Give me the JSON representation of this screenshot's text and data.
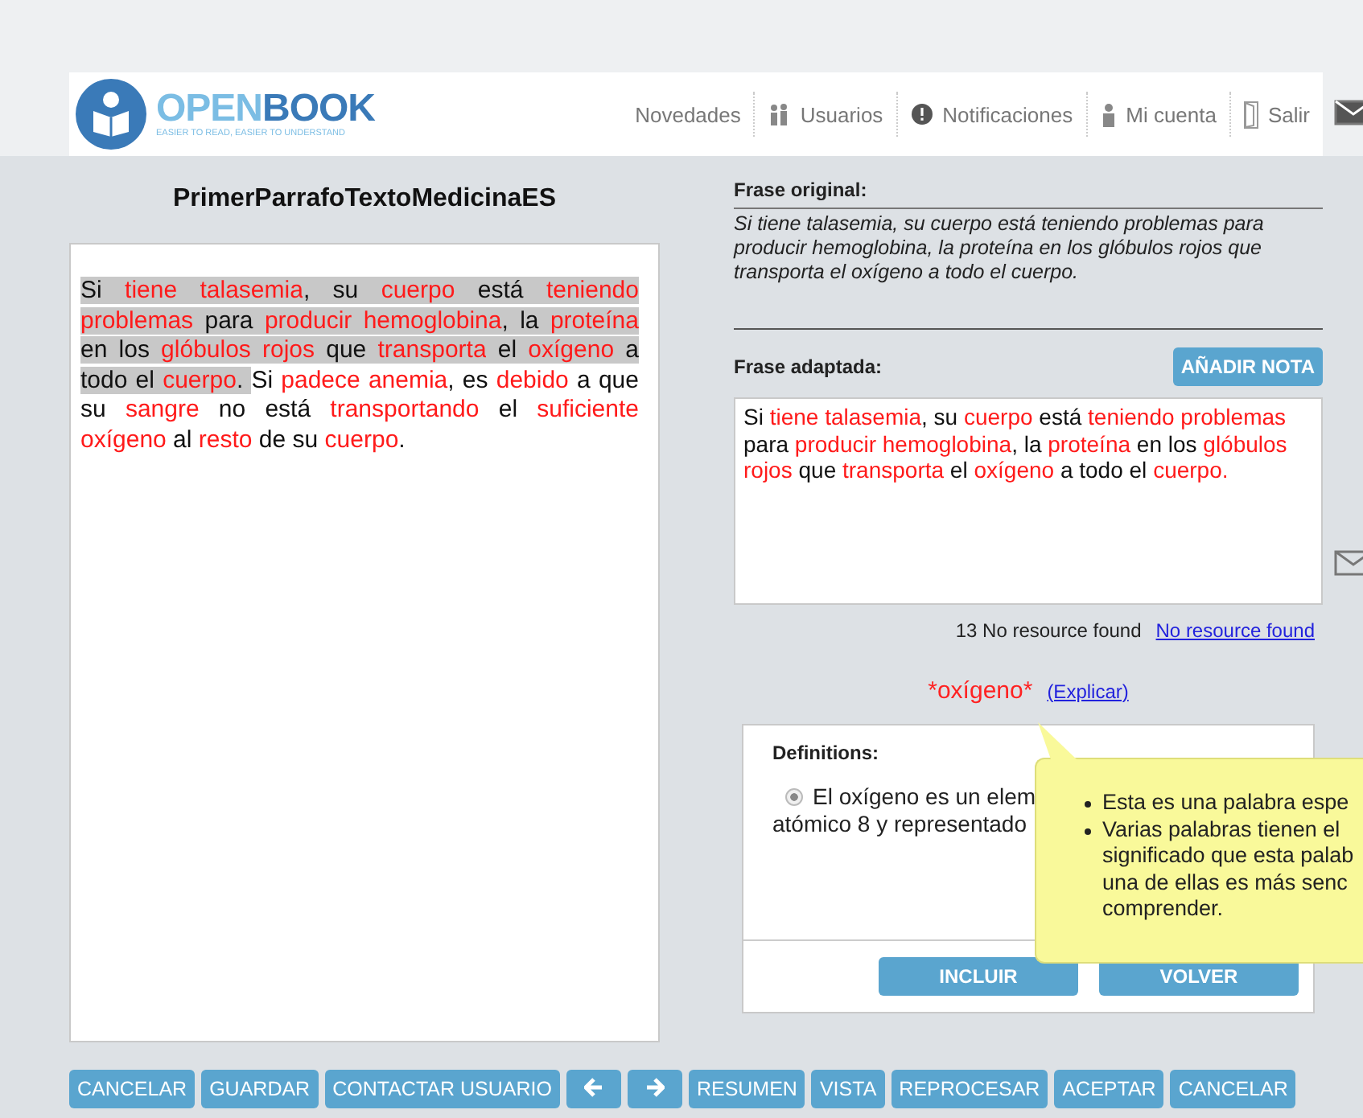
{
  "logo": {
    "name_first": "OPEN",
    "name_second": "BOOK",
    "tagline": "EASIER TO READ, EASIER TO UNDERSTAND"
  },
  "nav": [
    {
      "label": "Novedades",
      "kind": "plain"
    },
    {
      "label": "Usuarios",
      "kind": "users"
    },
    {
      "label": "Notificaciones",
      "kind": "alert"
    },
    {
      "label": "Mi cuenta",
      "kind": "person"
    },
    {
      "label": "Salir",
      "kind": "door"
    }
  ],
  "document": {
    "title": "PrimerParrafoTextoMedicinaES",
    "sentences": [
      {
        "selected": true,
        "segments": [
          {
            "text": "Si ",
            "difficult": false
          },
          {
            "text": "tiene talasemia",
            "difficult": true
          },
          {
            "text": ", su ",
            "difficult": false
          },
          {
            "text": "cuerpo",
            "difficult": true
          },
          {
            "text": " está ",
            "difficult": false
          },
          {
            "text": "teniendo problemas",
            "difficult": true
          },
          {
            "text": " para ",
            "difficult": false
          },
          {
            "text": "producir hemoglobina",
            "difficult": true
          },
          {
            "text": ", la ",
            "difficult": false
          },
          {
            "text": "proteína",
            "difficult": true
          },
          {
            "text": " en los ",
            "difficult": false
          },
          {
            "text": "glóbulos rojos",
            "difficult": true
          },
          {
            "text": " que ",
            "difficult": false
          },
          {
            "text": "transporta",
            "difficult": true
          },
          {
            "text": " el ",
            "difficult": false
          },
          {
            "text": "oxígeno",
            "difficult": true
          },
          {
            "text": " a todo el ",
            "difficult": false
          },
          {
            "text": "cuerpo",
            "difficult": true
          },
          {
            "text": ". ",
            "difficult": false
          }
        ]
      },
      {
        "selected": false,
        "segments": [
          {
            "text": "Si ",
            "difficult": false
          },
          {
            "text": "padece anemia",
            "difficult": true
          },
          {
            "text": ", es ",
            "difficult": false
          },
          {
            "text": "debido",
            "difficult": true
          },
          {
            "text": " a que su ",
            "difficult": false
          },
          {
            "text": "sangre",
            "difficult": true
          },
          {
            "text": " no está ",
            "difficult": false
          },
          {
            "text": "transportando",
            "difficult": true
          },
          {
            "text": " el ",
            "difficult": false
          },
          {
            "text": "suficiente",
            "difficult": true
          },
          {
            "text": " oxígeno",
            "difficult": true
          },
          {
            "text": " al ",
            "difficult": false
          },
          {
            "text": "resto",
            "difficult": true
          },
          {
            "text": " de su ",
            "difficult": false
          },
          {
            "text": "cuerpo",
            "difficult": true
          },
          {
            "text": ".",
            "difficult": false
          }
        ]
      }
    ]
  },
  "original": {
    "label": "Frase original:",
    "text": "Si tiene talasemia, su cuerpo está teniendo problemas para producir hemoglobina, la proteína en los glóbulos rojos que transporta el oxígeno a todo el cuerpo."
  },
  "adapted": {
    "label": "Frase adaptada:",
    "button": "AÑADIR NOTA",
    "segments": [
      {
        "text": "Si ",
        "difficult": false
      },
      {
        "text": "tiene talasemia",
        "difficult": true
      },
      {
        "text": ", su ",
        "difficult": false
      },
      {
        "text": "cuerpo",
        "difficult": true
      },
      {
        "text": " está ",
        "difficult": false
      },
      {
        "text": "teniendo problemas",
        "difficult": true
      },
      {
        "text": " para ",
        "difficult": false
      },
      {
        "text": "producir hemoglobina",
        "difficult": true
      },
      {
        "text": ", la ",
        "difficult": false
      },
      {
        "text": "proteína",
        "difficult": true
      },
      {
        "text": " en los ",
        "difficult": false
      },
      {
        "text": "glóbulos rojos",
        "difficult": true
      },
      {
        "text": " que ",
        "difficult": false
      },
      {
        "text": "transporta",
        "difficult": true
      },
      {
        "text": " el ",
        "difficult": false
      },
      {
        "text": "oxígeno",
        "difficult": true
      },
      {
        "text": " a todo el ",
        "difficult": false
      },
      {
        "text": "cuerpo.",
        "difficult": true
      }
    ]
  },
  "resources": {
    "status": "13 No resource found",
    "link": "No resource found"
  },
  "word": {
    "term": "*oxígeno*",
    "link": "(Explicar)"
  },
  "definitions": {
    "label": "Definitions:",
    "options": [
      {
        "lines": [
          "El oxígeno es un elem",
          "atómico 8 y representado"
        ],
        "selected": true
      }
    ],
    "buttons": [
      "INCLUIR",
      "VOLVER"
    ]
  },
  "tooltip": {
    "bullets": [
      [
        "Esta es una palabra espe"
      ],
      [
        "Varias palabras tienen el",
        "significado que esta palab",
        "una de ellas es más senc",
        "comprender."
      ]
    ]
  },
  "footer_buttons": [
    {
      "kind": "text",
      "label": "CANCELAR"
    },
    {
      "kind": "text",
      "label": "GUARDAR"
    },
    {
      "kind": "text",
      "label": "CONTACTAR USUARIO"
    },
    {
      "kind": "prev"
    },
    {
      "kind": "next"
    },
    {
      "kind": "text",
      "label": "RESUMEN"
    },
    {
      "kind": "text",
      "label": "VISTA"
    },
    {
      "kind": "text",
      "label": "REPROCESAR"
    },
    {
      "kind": "text",
      "label": "ACEPTAR"
    },
    {
      "kind": "text",
      "label": "CANCELAR"
    }
  ]
}
